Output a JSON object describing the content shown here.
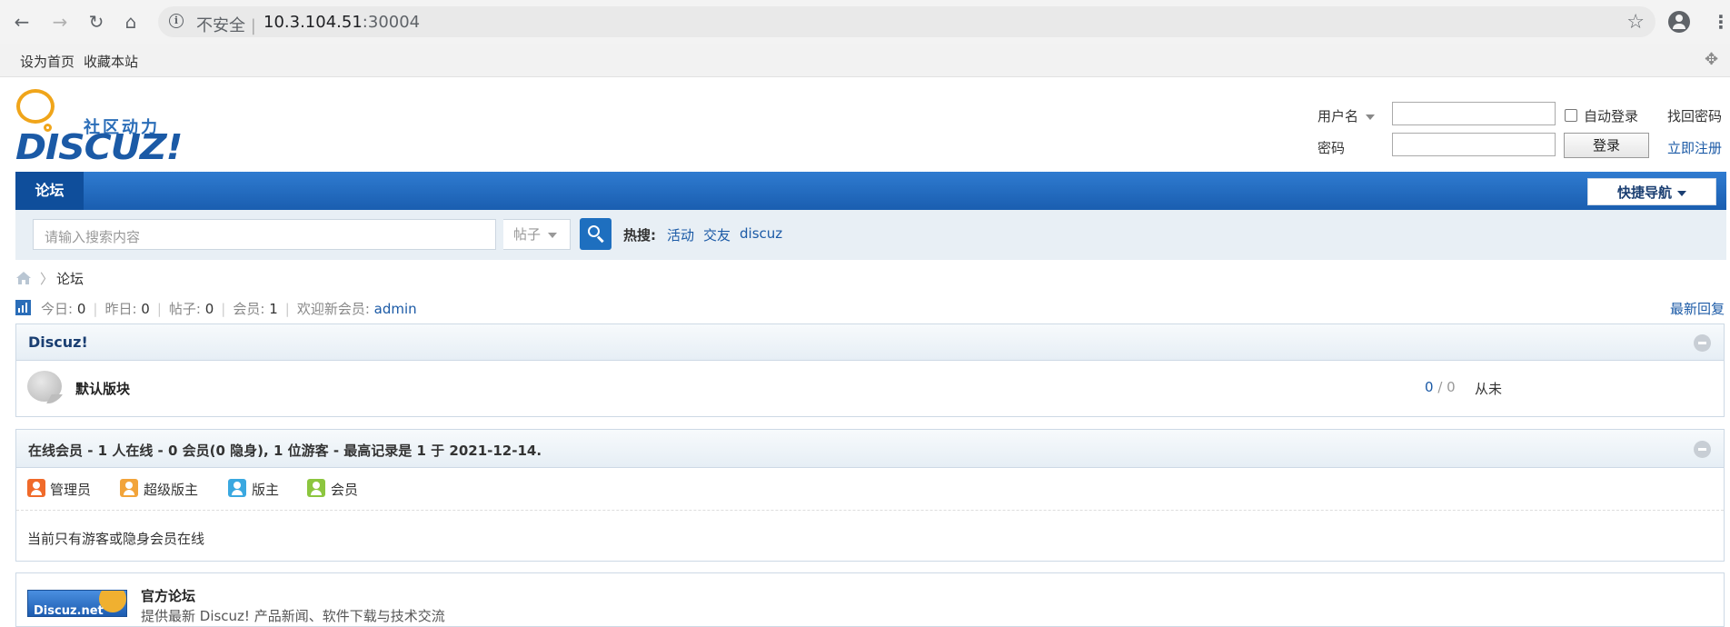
{
  "browser": {
    "security_label": "不安全",
    "divider": "|",
    "host": "10.3.104.51",
    "port": ":30004"
  },
  "toolbar": {
    "set_home": "设为首页",
    "bookmark": "收藏本站"
  },
  "logo": {
    "subtitle": "社区动力",
    "wordmark": "DISCUZ!"
  },
  "login": {
    "username_label": "用户名",
    "password_label": "密码",
    "auto_login": "自动登录",
    "submit": "登录",
    "forgot": "找回密码",
    "register": "立即注册"
  },
  "nav": {
    "active_tab": "论坛",
    "quick_nav": "快捷导航"
  },
  "search": {
    "placeholder": "请输入搜索内容",
    "type": "帖子",
    "hot_title": "热搜:",
    "hot_links": [
      "活动",
      "交友",
      "discuz"
    ]
  },
  "breadcrumb": {
    "current": "论坛"
  },
  "stats": {
    "today_label": "今日:",
    "today": "0",
    "yesterday_label": "昨日:",
    "yesterday": "0",
    "posts_label": "帖子:",
    "posts": "0",
    "members_label": "会员:",
    "members": "1",
    "welcome_label": "欢迎新会员:",
    "newest": "admin",
    "latest_replies": "最新回复"
  },
  "category": {
    "title": "Discuz!",
    "forum_name": "默认版块",
    "threads": "0",
    "slash": "/",
    "posts": "0",
    "last_post": "从未"
  },
  "online": {
    "title": "在线会员 - 1 人在线 - 0 会员(0 隐身), 1 位游客 - 最高记录是 1 于 2021-12-14.",
    "roles": [
      {
        "label": "管理员",
        "color": "#f06a2a"
      },
      {
        "label": "超级版主",
        "color": "#f2a43a"
      },
      {
        "label": "版主",
        "color": "#3aa8e0"
      },
      {
        "label": "会员",
        "color": "#8cc63f"
      }
    ],
    "note": "当前只有游客或隐身会员在线"
  },
  "links_panel": {
    "title": "官方论坛",
    "desc": "提供最新 Discuz! 产品新闻、软件下载与技术交流",
    "image_text": "Discuz.net"
  }
}
